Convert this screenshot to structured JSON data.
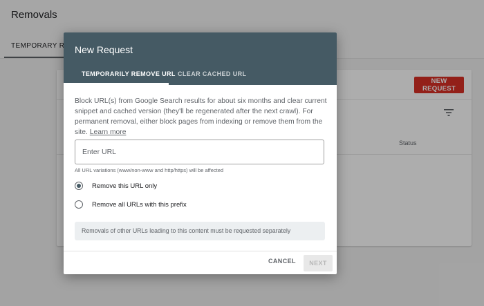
{
  "page": {
    "title": "Removals",
    "tab_label": "TEMPORARY REMOVALS",
    "new_request_label": "NEW REQUEST",
    "status_header": "Status"
  },
  "dialog": {
    "title": "New Request",
    "tabs": [
      {
        "label": "TEMPORARILY REMOVE URL",
        "active": true
      },
      {
        "label": "CLEAR CACHED URL",
        "active": false
      }
    ],
    "description": "Block URL(s) from Google Search results for about six months and clear current snippet and cached version (they'll be regenerated after the next crawl). For permanent removal, either block pages from indexing or remove them from the site.",
    "learn_more": "Learn more",
    "url_placeholder": "Enter URL",
    "url_value": "",
    "helper_text": "All URL variations (www/non-www and http/https) will be affected",
    "options": [
      {
        "label": "Remove this URL only",
        "selected": true
      },
      {
        "label": "Remove all URLs with this prefix",
        "selected": false
      }
    ],
    "note": "Removals of other URLs leading to this content must be requested separately",
    "cancel_label": "CANCEL",
    "next_label": "NEXT"
  },
  "colors": {
    "header_bg": "#455a64",
    "accent_red": "#d93025",
    "scrim": "rgba(0,0,0,0.32)"
  },
  "icons": {
    "filter": "filter-icon"
  }
}
